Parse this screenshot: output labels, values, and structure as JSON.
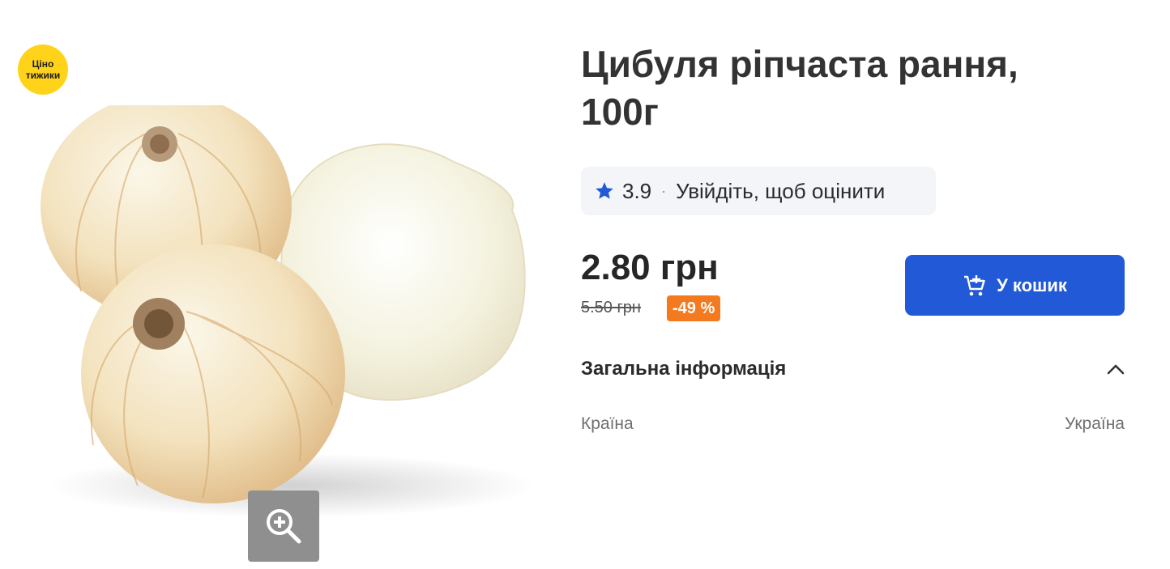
{
  "promo": {
    "badge_label": "Ціно\nтижики",
    "badge_color": "#ffd31a"
  },
  "product": {
    "title": "Цибуля ріпчаста рання, 100г",
    "image_icon": "onion-photo",
    "zoom_icon": "zoom-in-icon"
  },
  "rating": {
    "value": "3.9",
    "separator": "·",
    "login_prompt": "Увійдіть, щоб оцінити",
    "star_color": "#2159d6"
  },
  "price": {
    "current": "2.80 грн",
    "old": "5.50 грн",
    "discount": "-49 %",
    "discount_color": "#f47a20"
  },
  "cart": {
    "label": "У кошик",
    "icon": "cart-add-icon",
    "color": "#2159d6"
  },
  "info": {
    "section_title": "Загальна інформація",
    "toggle_icon": "chevron-up-icon",
    "rows": [
      {
        "label": "Країна",
        "value": "Україна"
      }
    ]
  }
}
